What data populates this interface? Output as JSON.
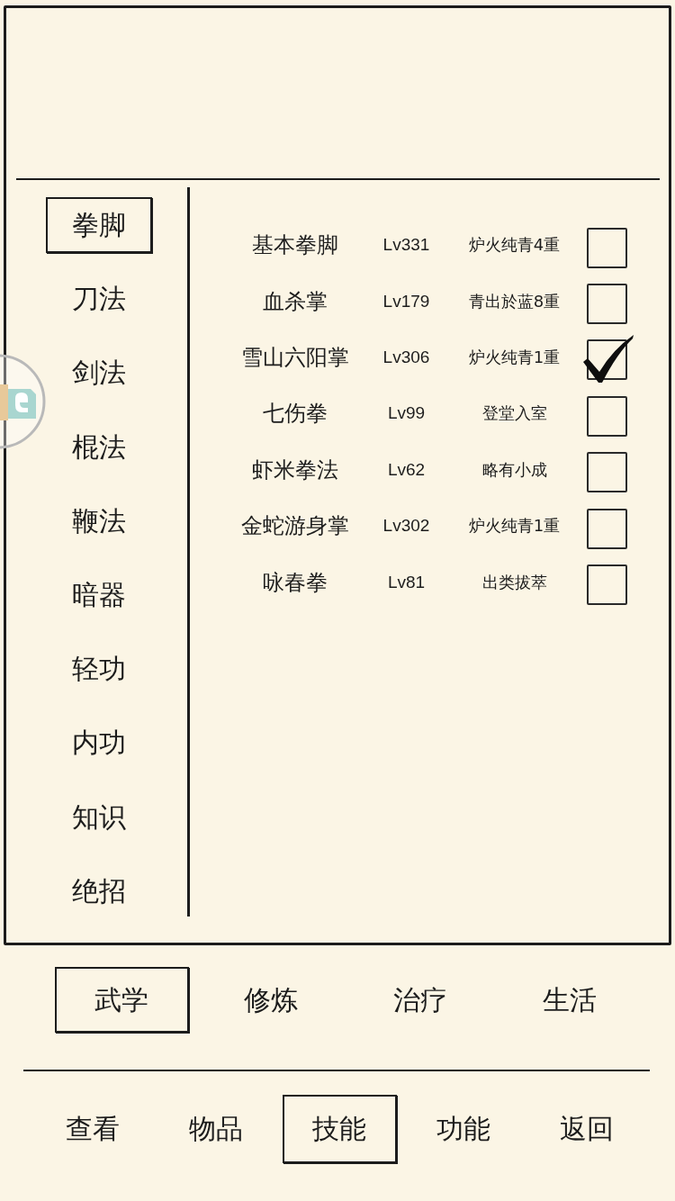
{
  "categories": [
    {
      "label": "拳脚",
      "selected": true
    },
    {
      "label": "刀法",
      "selected": false
    },
    {
      "label": "剑法",
      "selected": false
    },
    {
      "label": "棍法",
      "selected": false
    },
    {
      "label": "鞭法",
      "selected": false
    },
    {
      "label": "暗器",
      "selected": false
    },
    {
      "label": "轻功",
      "selected": false
    },
    {
      "label": "内功",
      "selected": false
    },
    {
      "label": "知识",
      "selected": false
    },
    {
      "label": "绝招",
      "selected": false
    }
  ],
  "skills": [
    {
      "name": "基本拳脚",
      "lv": "Lv331",
      "stage": "炉火纯青4重",
      "checked": false
    },
    {
      "name": "血杀掌",
      "lv": "Lv179",
      "stage": "青出於蓝8重",
      "checked": false
    },
    {
      "name": "雪山六阳掌",
      "lv": "Lv306",
      "stage": "炉火纯青1重",
      "checked": true
    },
    {
      "name": "七伤拳",
      "lv": "Lv99",
      "stage": "登堂入室",
      "checked": false
    },
    {
      "name": "虾米拳法",
      "lv": "Lv62",
      "stage": "略有小成",
      "checked": false
    },
    {
      "name": "金蛇游身掌",
      "lv": "Lv302",
      "stage": "炉火纯青1重",
      "checked": false
    },
    {
      "name": "咏春拳",
      "lv": "Lv81",
      "stage": "出类拔萃",
      "checked": false
    }
  ],
  "sub_tabs": [
    {
      "label": "武学",
      "selected": true
    },
    {
      "label": "修炼",
      "selected": false
    },
    {
      "label": "治疗",
      "selected": false
    },
    {
      "label": "生活",
      "selected": false
    }
  ],
  "nav_tabs": [
    {
      "label": "查看",
      "selected": false
    },
    {
      "label": "物品",
      "selected": false
    },
    {
      "label": "技能",
      "selected": true
    },
    {
      "label": "功能",
      "selected": false
    },
    {
      "label": "返回",
      "selected": false
    }
  ]
}
